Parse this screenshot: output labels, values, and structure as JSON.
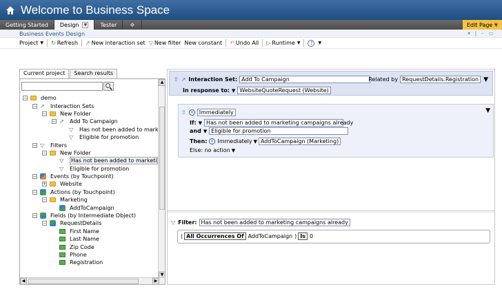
{
  "app": {
    "title": "Welcome to Business Space",
    "tabs": [
      {
        "label": "Getting Started"
      },
      {
        "label": "Design"
      },
      {
        "label": "Tester"
      }
    ],
    "edit_page": "Edit Page ¥"
  },
  "portlet": {
    "title": "Business Events Design"
  },
  "toolbar": {
    "project": "Project",
    "refresh": "Refresh",
    "new_interaction_set": "New interaction set",
    "new_filter": "New filter",
    "new_constant": "New constant",
    "undo_all": "Undo All",
    "runtime": "Runtime"
  },
  "left": {
    "tabs": [
      "Current project",
      "Search results"
    ],
    "search_value": "",
    "tree": [
      {
        "depth": 0,
        "toggle": "−",
        "icon": "folder",
        "label": "demo"
      },
      {
        "depth": 1,
        "toggle": "−",
        "icon": "interaction",
        "label": "Interaction Sets"
      },
      {
        "depth": 2,
        "toggle": "−",
        "icon": "folder",
        "label": "New Folder"
      },
      {
        "depth": 3,
        "toggle": "−",
        "icon": "interaction",
        "label": "Add To Campaign"
      },
      {
        "depth": 4,
        "toggle": "",
        "icon": "filter",
        "label": "Has not been added to marketing ca"
      },
      {
        "depth": 4,
        "toggle": "",
        "icon": "filter",
        "label": "Eligible for promotion"
      },
      {
        "depth": 1,
        "toggle": "−",
        "icon": "filter",
        "label": "Filters"
      },
      {
        "depth": 2,
        "toggle": "−",
        "icon": "folder",
        "label": "New Folder"
      },
      {
        "depth": 3,
        "toggle": "",
        "icon": "filter",
        "label": "Has not been added to marketing camp",
        "selected": true
      },
      {
        "depth": 3,
        "toggle": "",
        "icon": "filter",
        "label": "Eligible for promotion"
      },
      {
        "depth": 1,
        "toggle": "−",
        "icon": "events",
        "label": "Events (by Touchpoint)"
      },
      {
        "depth": 2,
        "toggle": "+",
        "icon": "folder",
        "label": "Website"
      },
      {
        "depth": 1,
        "toggle": "−",
        "icon": "actions",
        "label": "Actions (by Touchpoint)"
      },
      {
        "depth": 2,
        "toggle": "−",
        "icon": "folder",
        "label": "Marketing"
      },
      {
        "depth": 3,
        "toggle": "",
        "icon": "actions",
        "label": "AddToCampaign"
      },
      {
        "depth": 1,
        "toggle": "−",
        "icon": "fields",
        "label": "Fields (by Intermediate Object)"
      },
      {
        "depth": 2,
        "toggle": "−",
        "icon": "fields",
        "label": "RequestDetails"
      },
      {
        "depth": 3,
        "toggle": "",
        "icon": "field",
        "label": "First Name"
      },
      {
        "depth": 3,
        "toggle": "",
        "icon": "field",
        "label": "Last Name"
      },
      {
        "depth": 3,
        "toggle": "",
        "icon": "field",
        "label": "Zip Code"
      },
      {
        "depth": 3,
        "toggle": "",
        "icon": "field",
        "label": "Phone"
      },
      {
        "depth": 3,
        "toggle": "",
        "icon": "field",
        "label": "Registration"
      }
    ]
  },
  "interaction": {
    "label": "Interaction Set:",
    "name": "Add To Campaign",
    "related_label": "Related by",
    "related_value": "RequestDetails.Registration",
    "in_response_label": "In response to:",
    "in_response_value": "WebsiteQuoteRequest (Website)"
  },
  "rule": {
    "timing": "Immediately",
    "if_label": "If:",
    "if_value": "Has not been added to marketing campaigns already",
    "and_label": "and",
    "and_value": "Eligible for promotion",
    "then_label": "Then:",
    "then_timing": "Immediately",
    "then_action": "AddToCampaign (Marketing)",
    "else_label": "Else: no action"
  },
  "filter": {
    "label": "Filter:",
    "name": "Has not been added to marketing campaigns already",
    "open_paren": "(",
    "all_occ": "All Occurrences Of",
    "target": "AddToCampaign",
    "close_paren": ")",
    "is": "Is",
    "value": "0"
  },
  "colors": {
    "title_bar": "#2b5a8e",
    "tab_bar": "#555555",
    "edit_page": "#f5c242",
    "header_panel": "#dde3f3",
    "rule_panel": "#eef1f9"
  }
}
